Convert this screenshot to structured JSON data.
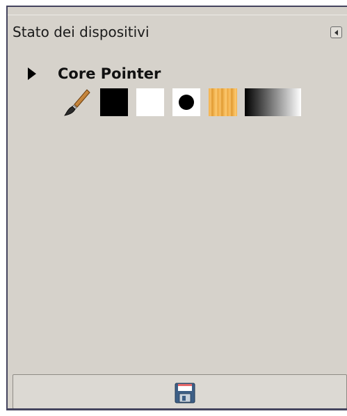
{
  "panel": {
    "title": "Stato dei dispositivi",
    "menu_button_icon": "tab-menu-icon"
  },
  "device": {
    "name": "Core Pointer",
    "expander_icon": "triangle-right-icon",
    "tool_icon": "paintbrush-icon",
    "foreground_color": "#000000",
    "background_color": "#ffffff",
    "brush": "circle",
    "pattern": "wood",
    "gradient": "black-to-white"
  },
  "footer": {
    "save_icon": "floppy-disk-icon"
  }
}
